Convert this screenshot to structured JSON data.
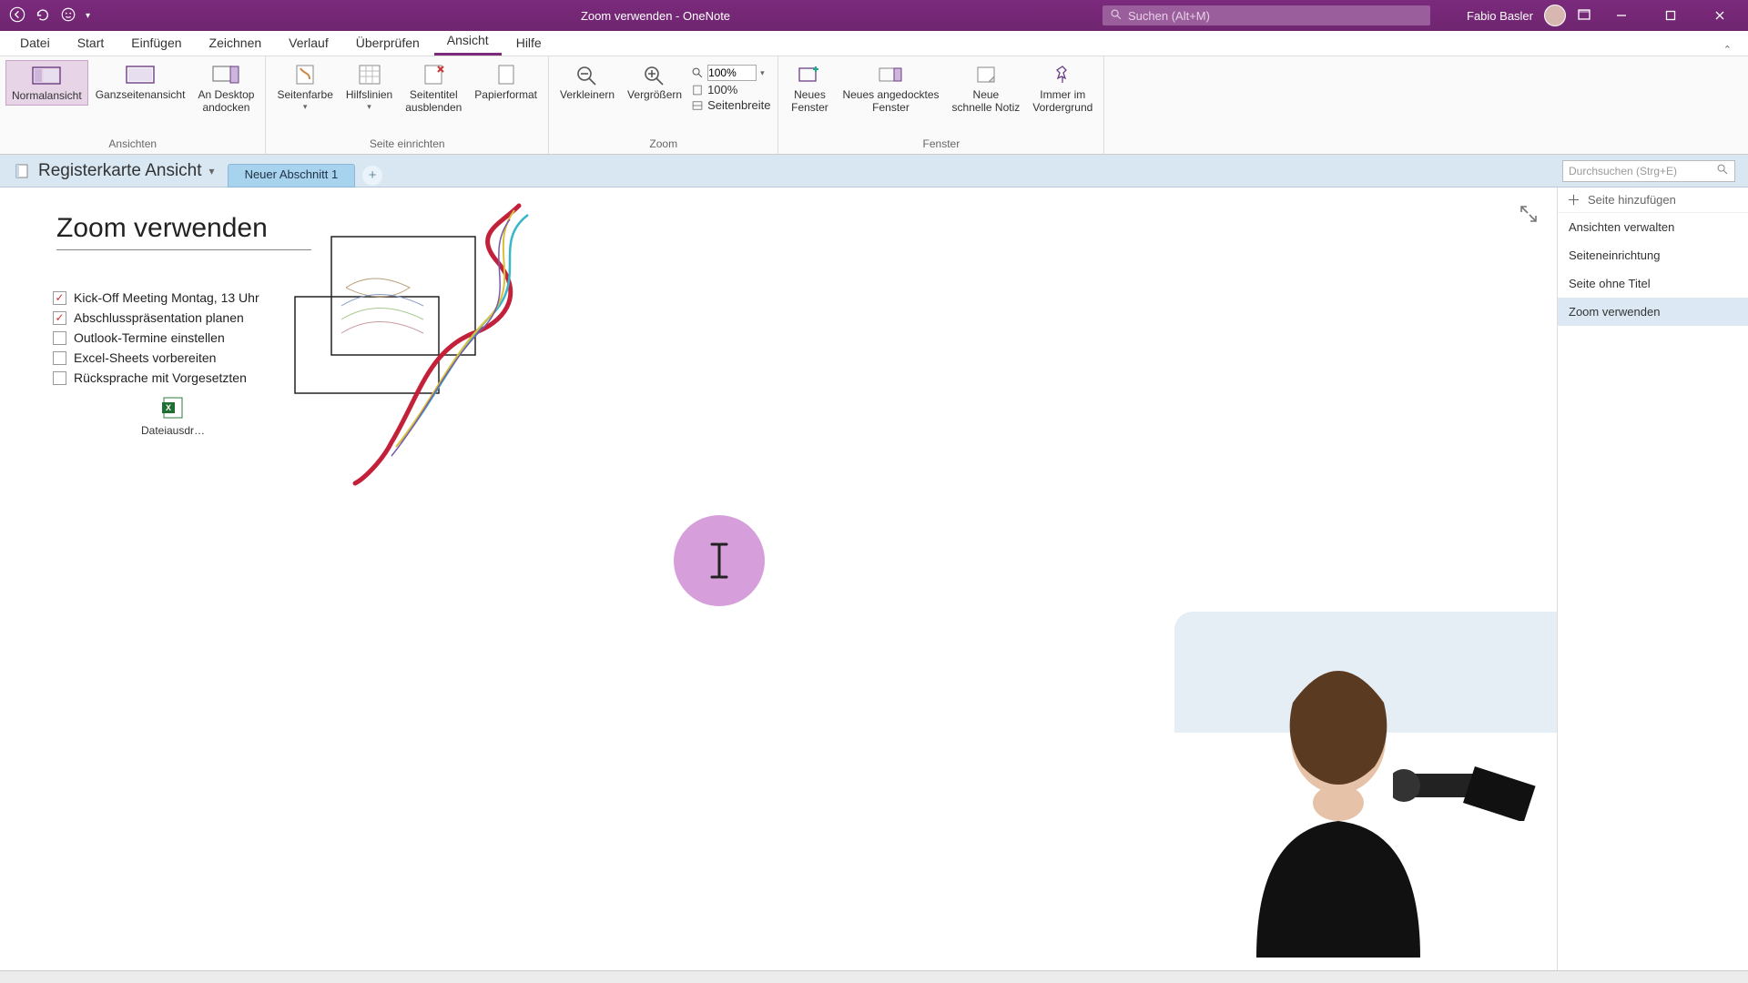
{
  "titlebar": {
    "doc_title": "Zoom verwenden",
    "app_name": "OneNote",
    "separator": "  -  ",
    "search_placeholder": "Suchen (Alt+M)",
    "user_name": "Fabio Basler"
  },
  "menu": {
    "tabs": [
      "Datei",
      "Start",
      "Einfügen",
      "Zeichnen",
      "Verlauf",
      "Überprüfen",
      "Ansicht",
      "Hilfe"
    ],
    "active_index": 6
  },
  "ribbon": {
    "groups": {
      "views": {
        "label": "Ansichten",
        "normal": "Normalansicht",
        "fullpage": "Ganzseitenansicht",
        "dock_l1": "An Desktop",
        "dock_l2": "andocken"
      },
      "page_setup": {
        "label": "Seite einrichten",
        "pagecolor": "Seitenfarbe",
        "gridlines": "Hilfslinien",
        "hide_title_l1": "Seitentitel",
        "hide_title_l2": "ausblenden",
        "paper": "Papierformat"
      },
      "zoom": {
        "label": "Zoom",
        "out": "Verkleinern",
        "in": "Vergrößern",
        "value": "100%",
        "hundred": "100%",
        "pagewidth": "Seitenbreite"
      },
      "window": {
        "label": "Fenster",
        "new_l1": "Neues",
        "new_l2": "Fenster",
        "docked_l1": "Neues angedocktes",
        "docked_l2": "Fenster",
        "quick_l1": "Neue",
        "quick_l2": "schnelle Notiz",
        "ontop_l1": "Immer im",
        "ontop_l2": "Vordergrund"
      }
    }
  },
  "notebook": {
    "name": "Registerkarte Ansicht",
    "section_tab": "Neuer Abschnitt 1",
    "page_search_placeholder": "Durchsuchen (Strg+E)"
  },
  "page": {
    "title": "Zoom verwenden",
    "todos": [
      {
        "checked": true,
        "text": "Kick-Off Meeting Montag, 13 Uhr"
      },
      {
        "checked": true,
        "text": "Abschlusspräsentation planen"
      },
      {
        "checked": false,
        "text": "Outlook-Termine einstellen"
      },
      {
        "checked": false,
        "text": "Excel-Sheets vorbereiten"
      },
      {
        "checked": false,
        "text": "Rücksprache mit Vorgesetzten"
      }
    ],
    "file_label": "Dateiausdr…"
  },
  "rightpanel": {
    "add_page": "Seite hinzufügen",
    "pages": [
      "Ansichten verwalten",
      "Seiteneinrichtung",
      "Seite ohne Titel",
      "Zoom verwenden"
    ],
    "active_index": 3
  }
}
